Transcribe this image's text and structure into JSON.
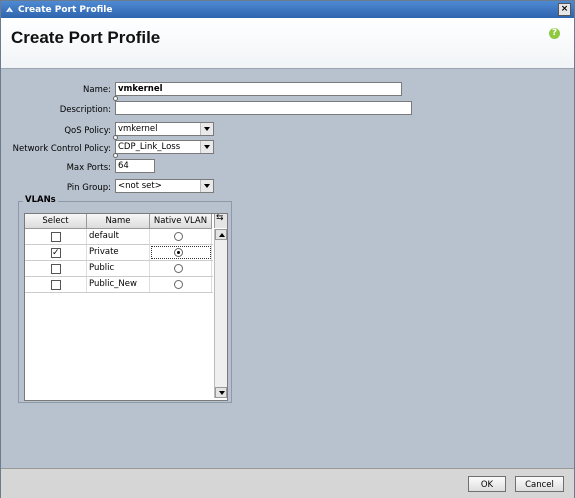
{
  "window": {
    "title": "Create Port Profile"
  },
  "header": {
    "title": "Create Port Profile",
    "help": "?"
  },
  "form": {
    "name_label": "Name:",
    "name_value": "vmkernel",
    "description_label": "Description:",
    "description_value": "",
    "qos_label": "QoS Policy:",
    "qos_value": "vmkernel",
    "ncp_label": "Network Control Policy:",
    "ncp_value": "CDP_Link_Loss",
    "maxports_label": "Max Ports:",
    "maxports_value": "64",
    "pingroup_label": "Pin Group:",
    "pingroup_value": "<not set>"
  },
  "vlans": {
    "legend": "VLANs",
    "columns": [
      "Select",
      "Name",
      "Native VLAN"
    ],
    "rows": [
      {
        "select": false,
        "name": "default",
        "native": false
      },
      {
        "select": true,
        "name": "Private",
        "native": true
      },
      {
        "select": false,
        "name": "Public",
        "native": false
      },
      {
        "select": false,
        "name": "Public_New",
        "native": false
      }
    ]
  },
  "footer": {
    "ok": "OK",
    "cancel": "Cancel"
  }
}
